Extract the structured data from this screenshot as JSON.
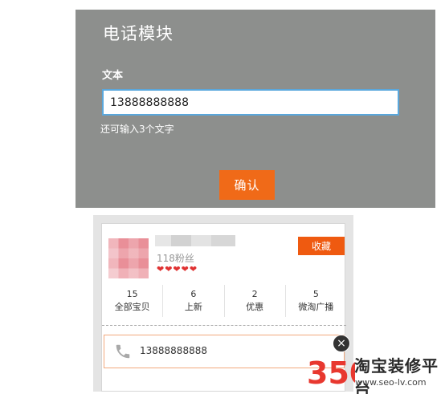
{
  "dialog": {
    "title": "电话模块",
    "field_label": "文本",
    "phone_value": "13888888888",
    "remaining_hint": "还可输入3个文字",
    "confirm_label": "确认"
  },
  "preview": {
    "fans": "118粉丝",
    "stars": "❤❤❤❤❤",
    "follow_label": "收藏",
    "stats": [
      {
        "num": "15",
        "label": "全部宝贝"
      },
      {
        "num": "6",
        "label": "上新"
      },
      {
        "num": "2",
        "label": "优惠"
      },
      {
        "num": "5",
        "label": "微淘广播"
      }
    ],
    "phone_number": "13888888888"
  },
  "watermark": {
    "logo_text": "350",
    "name": "淘宝装修平台",
    "url": "www.seo-lv.com"
  },
  "colors": {
    "accent_orange": "#f06a18",
    "dialog_bg": "#8d8f8d",
    "input_border": "#5aa7dc"
  }
}
